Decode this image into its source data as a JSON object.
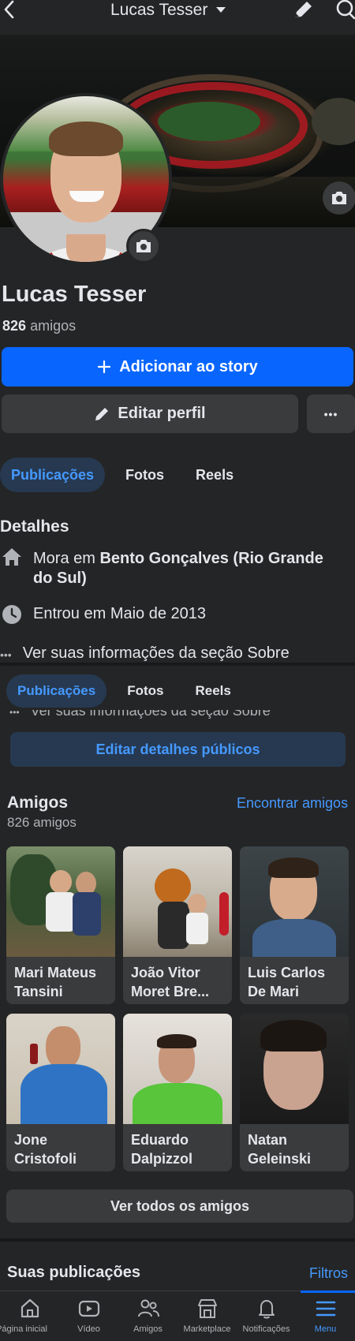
{
  "header": {
    "profile_name": "Lucas Tesser"
  },
  "profile": {
    "name": "Lucas Tesser",
    "friends_count": "826",
    "friends_suffix": "amigos"
  },
  "actions": {
    "add_story": "Adicionar ao story",
    "edit_profile": "Editar perfil",
    "more": "•••"
  },
  "tabs": [
    "Publicações",
    "Fotos",
    "Reels"
  ],
  "details": {
    "title": "Detalhes",
    "lives_prefix": "Mora em ",
    "lives_city": "Bento Gonçalves (Rio Grande do Sul)",
    "joined": "Entrou em Maio de 2013",
    "about": "Ver suas informações da seção Sobre",
    "edit_public": "Editar detalhes públicos"
  },
  "friends": {
    "title": "Amigos",
    "count_label": "826 amigos",
    "find": "Encontrar amigos",
    "see_all": "Ver todos os amigos",
    "list": [
      {
        "name": "Mari Mateus Tansini"
      },
      {
        "name": "João Vitor Moret Bre..."
      },
      {
        "name": "Luis Carlos De Mari"
      },
      {
        "name": "Jone Cristofoli"
      },
      {
        "name": "Eduardo Dalpizzol"
      },
      {
        "name": "Natan Geleinski"
      }
    ]
  },
  "posts": {
    "title": "Suas publicações",
    "filters": "Filtros"
  },
  "bottom_nav": [
    {
      "label": "Página inicial",
      "icon": "home-icon",
      "active": false
    },
    {
      "label": "Vídeo",
      "icon": "video-icon",
      "active": false
    },
    {
      "label": "Amigos",
      "icon": "friends-icon",
      "active": false
    },
    {
      "label": "Marketplace",
      "icon": "marketplace-icon",
      "active": false
    },
    {
      "label": "Notificações",
      "icon": "bell-icon",
      "active": false
    },
    {
      "label": "Menu",
      "icon": "menu-icon",
      "active": true
    }
  ],
  "colors": {
    "accent": "#0866ff",
    "link": "#4599ff",
    "background": "#242526",
    "surface": "#3a3b3c"
  }
}
